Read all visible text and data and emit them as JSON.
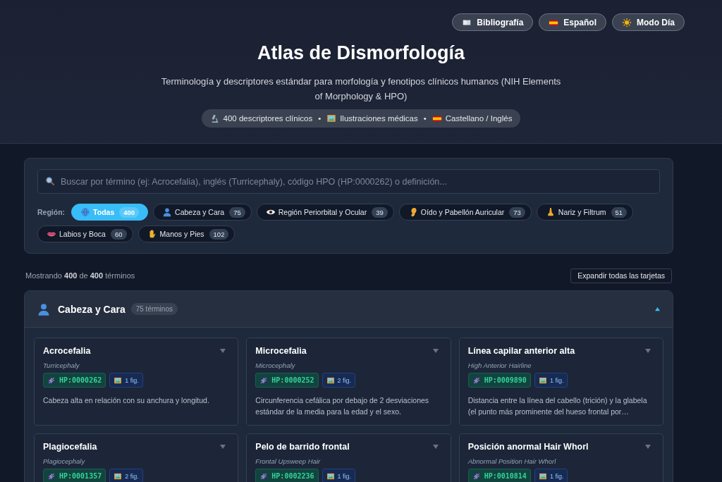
{
  "header": {
    "nav_buttons": [
      {
        "label": "Bibliografía"
      },
      {
        "label": "Español"
      },
      {
        "label": "Modo Día"
      }
    ],
    "title": "Atlas de Dismorfología",
    "subtitle": "Terminología y descriptores estándar para morfología y fenotipos clínicos humanos (NIH Elements of Morphology & HPO)",
    "stats": [
      {
        "text": "400 descriptores clínicos"
      },
      {
        "text": "Ilustraciones médicas"
      },
      {
        "text": "Castellano / Inglés"
      }
    ],
    "stats_separator": "•"
  },
  "search": {
    "placeholder": "Buscar por término (ej: Acrocefalia), inglés (Turricephaly), código HPO (HP:0000262) o definición..."
  },
  "filters": {
    "label": "Región:",
    "items": [
      {
        "label": "Todas",
        "count": "400",
        "selected": true
      },
      {
        "label": "Cabeza y Cara",
        "count": "75",
        "selected": false
      },
      {
        "label": "Región Periorbital y Ocular",
        "count": "39",
        "selected": false
      },
      {
        "label": "Oído y Pabellón Auricular",
        "count": "73",
        "selected": false
      },
      {
        "label": "Nariz y Filtrum",
        "count": "51",
        "selected": false
      },
      {
        "label": "Labios y Boca",
        "count": "60",
        "selected": false
      },
      {
        "label": "Manos y Pies",
        "count": "102",
        "selected": false
      }
    ]
  },
  "results": {
    "summary": "Mostrando **400** de **400** términos",
    "expand_button": "Expandir todas las tarjetas"
  },
  "sections": [
    {
      "title": "Cabeza y Cara",
      "count": "75 términos",
      "expanded": true,
      "cards": [
        {
          "term": "Acrocefalia",
          "english": "Turricephaly",
          "hpo": "HP:0000262",
          "figures": "1 fig.",
          "definition": "Cabeza alta en relación con su anchura y longitud.",
          "expanded": false
        },
        {
          "term": "Microcefalia",
          "english": "Microcephaly",
          "hpo": "HP:0000252",
          "figures": "2 fig.",
          "definition": "Circunferencia cefálica por debajo de 2 desviaciones estándar de la media para la edad y el sexo.",
          "expanded": false
        },
        {
          "term": "Línea capilar anterior alta",
          "english": "High Anterior Hairline",
          "hpo": "HP:0009890",
          "figures": "1 fig.",
          "definition": "Distancia entre la línea del cabello (trición) y la glabela (el punto más prominente del hueso frontal por…",
          "expanded": false
        },
        {
          "term": "Plagiocefalia",
          "english": "Plagiocephaly",
          "hpo": "HP:0001357",
          "figures": "2 fig.",
          "expanded": false
        },
        {
          "term": "Pelo de barrido frontal",
          "english": "Frontal Upsweep Hair",
          "hpo": "HP:0002236",
          "figures": "1 fig.",
          "expanded": false
        },
        {
          "term": "Posición anormal Hair Whorl",
          "english": "Abnormal Position Hair Whorl",
          "hpo": "HP:0010814",
          "figures": "1 fig.",
          "expanded": false
        }
      ]
    }
  ]
}
